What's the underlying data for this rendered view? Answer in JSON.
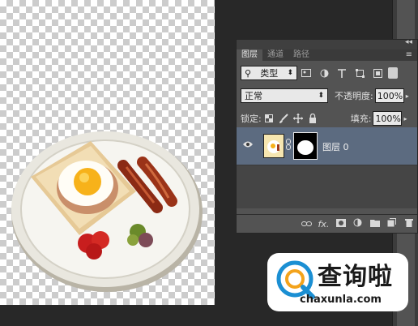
{
  "panel": {
    "collapse_label": "◂◂",
    "menu_label": "≡",
    "tabs": [
      {
        "label": "图层"
      },
      {
        "label": "通道"
      },
      {
        "label": "路径"
      }
    ],
    "filter": {
      "kind_label": "类型",
      "search_icon": "⚲",
      "arrows": "⬍"
    },
    "blend": {
      "mode": "正常",
      "opacity_label": "不透明度:",
      "opacity_value": "100%"
    },
    "lock": {
      "label": "锁定:",
      "fill_label": "填充:",
      "fill_value": "100%"
    },
    "layer": {
      "name": "图层 0"
    }
  },
  "watermark": {
    "brand_cn": "查询啦",
    "brand_url": "chaxunla.com"
  },
  "colors": {
    "accent": "#1b8fd3",
    "layer_selected": "#5c6b80"
  }
}
